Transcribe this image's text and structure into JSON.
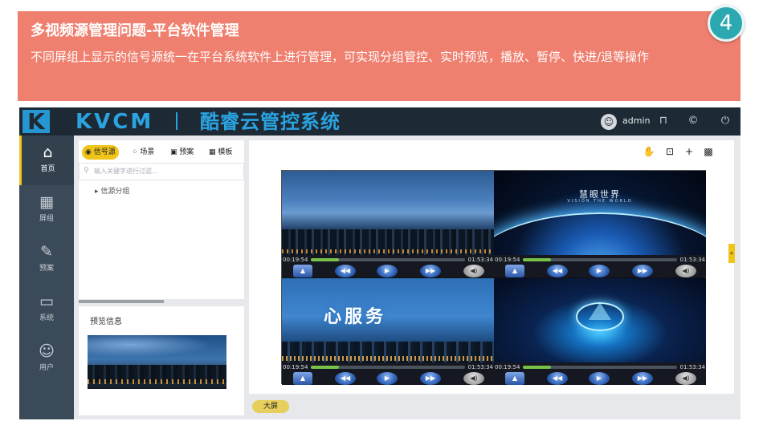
{
  "banner": {
    "badge": "4",
    "title": "多视频源管理问题-平台软件管理",
    "description": "不同屏组上显示的信号源统一在平台系统软件上进行管理，可实现分组管控、实时预览，播放、暂停、快进/退等操作"
  },
  "app": {
    "logo": "K",
    "brand": "KVCM",
    "brand_cn": "酷睿云管控系统",
    "user": "admin",
    "icons": [
      "user-icon",
      "lock-icon",
      "copyright-icon",
      "power-icon"
    ]
  },
  "nav": [
    {
      "label": "首页",
      "icon": "home-icon",
      "glyph": "⌂"
    },
    {
      "label": "屏组",
      "icon": "screen-group-icon",
      "glyph": "▦"
    },
    {
      "label": "预案",
      "icon": "plan-icon",
      "glyph": "✎"
    },
    {
      "label": "系统",
      "icon": "monitor-icon",
      "glyph": "▭"
    },
    {
      "label": "用户",
      "icon": "user-icon",
      "glyph": "☺"
    }
  ],
  "tabs": [
    {
      "label": "信号源",
      "icon": "signal-icon"
    },
    {
      "label": "场景",
      "icon": "scene-icon"
    },
    {
      "label": "预案",
      "icon": "plan-icon"
    },
    {
      "label": "模板",
      "icon": "template-icon"
    }
  ],
  "search": {
    "placeholder": "输入关键字进行过滤..."
  },
  "tree": {
    "item": "信源分组"
  },
  "preview": {
    "title": "预览信息"
  },
  "toolbar": {
    "icons": [
      "hand-icon",
      "chart-icon",
      "plus-icon",
      "qrcode-icon"
    ]
  },
  "tiles": [
    {
      "name": "city-skyline",
      "elapsed": "00:19:54",
      "total": "01:53:34",
      "progress": 0.18
    },
    {
      "name": "vision-world",
      "title": "慧眼世界",
      "subtitle": "VISION THE WORLD",
      "elapsed": "00:19:54",
      "total": "01:53:34",
      "progress": 0.18
    },
    {
      "name": "service",
      "title": "心服务",
      "elapsed": "00:19:54",
      "total": "01:53:34",
      "progress": 0.18
    },
    {
      "name": "tech-network",
      "elapsed": "00:19:54",
      "total": "01:53:34",
      "progress": 0.18
    }
  ],
  "side_toggle": "«",
  "big_screen": "大屏"
}
